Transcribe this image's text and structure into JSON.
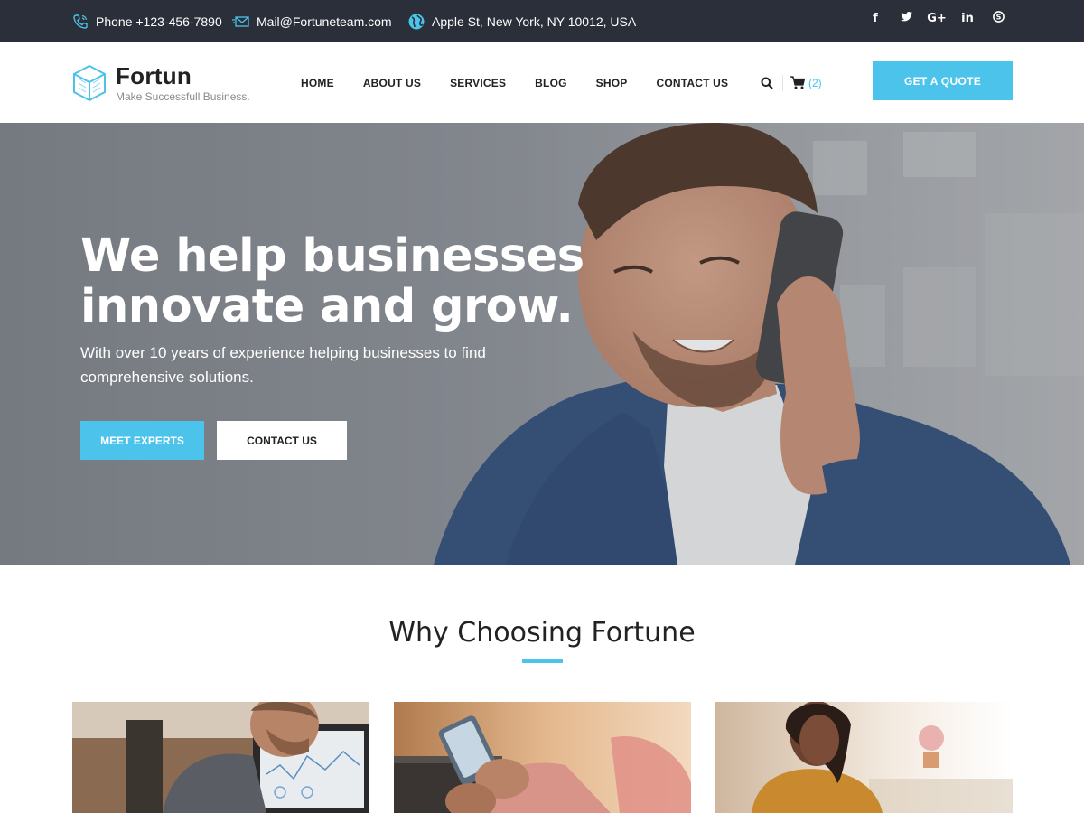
{
  "topbar": {
    "phone": "Phone +123-456-7890",
    "email": "Mail@Fortuneteam.com",
    "address": "Apple St, New York, NY 10012, USA",
    "social": [
      "f",
      "t",
      "G+",
      "in",
      "S"
    ]
  },
  "header": {
    "brand": "Fortun",
    "tagline": "Make Successfull Business.",
    "nav": [
      "HOME",
      "ABOUT US",
      "SERVICES",
      "BLOG",
      "SHOP",
      "CONTACT US"
    ],
    "cart_count": "(2)",
    "quote_label": "GET A QUOTE"
  },
  "hero": {
    "title_line1": "We help businesses",
    "title_line2": "innovate and grow.",
    "subtitle": "With over 10 years of experience helping businesses to find comprehensive solutions.",
    "btn_experts": "MEET EXPERTS",
    "btn_contact": "CONTACT US"
  },
  "why": {
    "title": "Why Choosing Fortune"
  },
  "colors": {
    "accent": "#4cc3ea",
    "topbar_bg": "#2b2f3a"
  },
  "icons": {
    "phone": "phone-icon",
    "mail": "mail-icon",
    "globe": "globe-icon",
    "search": "search-icon",
    "cart": "cart-icon",
    "logo": "cube-logo-icon"
  }
}
